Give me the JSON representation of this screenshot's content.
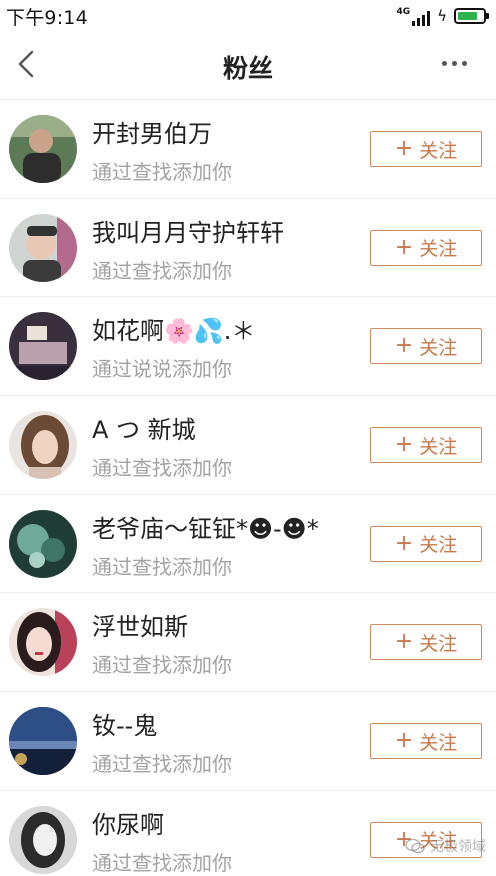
{
  "status_bar": {
    "time": "下午9:14",
    "network": "4G"
  },
  "header": {
    "title": "粉丝"
  },
  "follow_label": "关注",
  "followers": [
    {
      "name": "开封男伯万",
      "source": "通过查找添加你"
    },
    {
      "name": "我叫月月守护轩轩",
      "source": "通过查找添加你"
    },
    {
      "name": "如花啊🌸💦.＊",
      "source": "通过说说添加你"
    },
    {
      "name": "A つ 新城",
      "source": "通过查找添加你"
    },
    {
      "name": "老爷庙～钲钲*☻-☻*",
      "source": "通过查找添加你"
    },
    {
      "name": "浮世如斯",
      "source": "通过查找添加你"
    },
    {
      "name": "钕--鬼",
      "source": "通过查找添加你"
    },
    {
      "name": "你尿啊",
      "source": "通过查找添加你"
    }
  ],
  "watermark": {
    "text": "无极领域"
  }
}
